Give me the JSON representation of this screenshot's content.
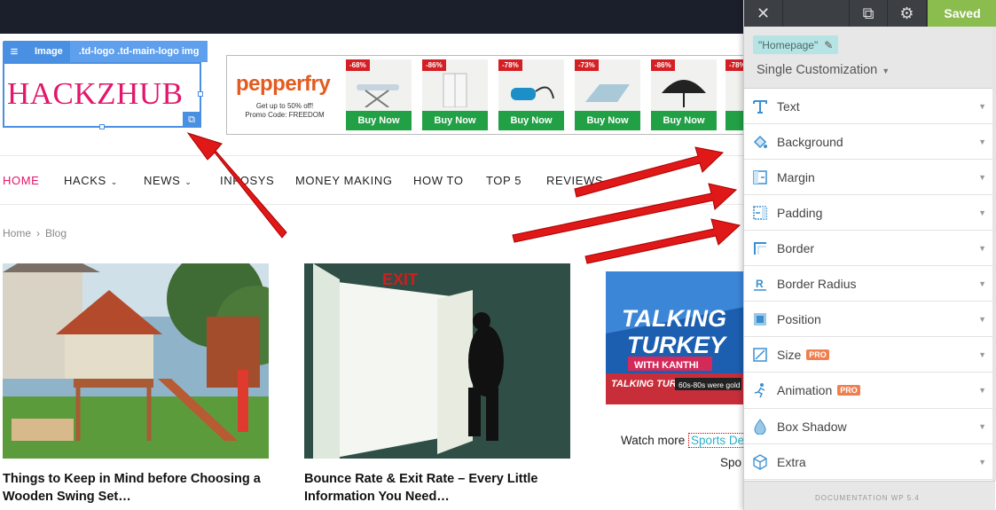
{
  "logo": {
    "text": "HACKZHUB"
  },
  "selection": {
    "element_type": "Image",
    "selector": ".td-logo .td-main-logo img"
  },
  "ad": {
    "brand": "pepperfry",
    "line1": "Get up to 50% off!",
    "line2": "Promo Code: FREEDOM",
    "items": [
      {
        "discount": "-68%",
        "button": "Buy Now"
      },
      {
        "discount": "-86%",
        "button": "Buy Now"
      },
      {
        "discount": "-78%",
        "button": "Buy Now"
      },
      {
        "discount": "-73%",
        "button": "Buy Now"
      },
      {
        "discount": "-86%",
        "button": "Buy Now"
      },
      {
        "discount": "-78%",
        "button": "B"
      }
    ]
  },
  "nav": {
    "items": [
      "HOME",
      "HACKS",
      "NEWS",
      "INFOSYS",
      "MONEY MAKING",
      "HOW TO",
      "TOP 5",
      "REVIEWS"
    ]
  },
  "breadcrumb": {
    "home": "Home",
    "current": "Blog"
  },
  "posts": [
    {
      "title": "Things to Keep in Mind before Choosing a Wooden Swing Set…"
    },
    {
      "title": "Bounce Rate & Exit Rate – Every Little Information You Need…",
      "image_sign": "EXIT"
    }
  ],
  "sidebar_promo": {
    "headline_1": "TALKING",
    "headline_2": "TURKEY",
    "sub": "WITH KANTHI",
    "small_title": "TALKING TURKEY",
    "tagline": "60s-80s were gold",
    "watch_prefix": "Watch more",
    "watch_link": "Sports De",
    "watch_next": "Spo"
  },
  "panel": {
    "saved_label": "Saved",
    "page_chip": "\"Homepage\"",
    "mode": "Single Customization",
    "options": [
      {
        "label": "Text",
        "icon": "text-icon"
      },
      {
        "label": "Background",
        "icon": "paint-bucket-icon"
      },
      {
        "label": "Margin",
        "icon": "margin-icon"
      },
      {
        "label": "Padding",
        "icon": "padding-icon"
      },
      {
        "label": "Border",
        "icon": "border-icon"
      },
      {
        "label": "Border Radius",
        "icon": "border-radius-icon"
      },
      {
        "label": "Position",
        "icon": "position-icon"
      },
      {
        "label": "Size",
        "icon": "size-icon",
        "badge": "PRO"
      },
      {
        "label": "Animation",
        "icon": "running-figure-icon",
        "badge": "PRO"
      },
      {
        "label": "Box Shadow",
        "icon": "drop-icon"
      },
      {
        "label": "Extra",
        "icon": "cube-icon"
      }
    ],
    "footer": "DOCUMENTATION   WP 5.4"
  },
  "colors": {
    "logo_pink": "#e3166c",
    "selection_blue": "#4a90e2",
    "saved_green": "#8bbc4e",
    "pro_orange": "#f07f4f",
    "arrow_red": "#e01818"
  }
}
